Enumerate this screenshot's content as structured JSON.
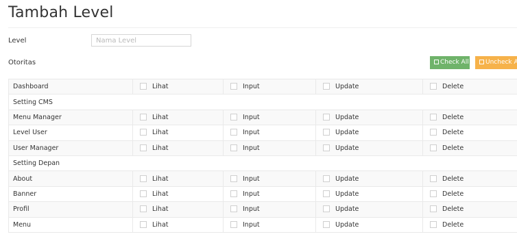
{
  "page": {
    "title": "Tambah Level"
  },
  "form": {
    "level_label": "Level",
    "level_placeholder": "Nama Level",
    "level_value": "",
    "otoritas_label": "Otoritas",
    "check_all_label": "Check All",
    "uncheck_all_label": "Uncheck A"
  },
  "actions": {
    "lihat": "Lihat",
    "input": "Input",
    "update": "Update",
    "delete": "Delete"
  },
  "rows": [
    {
      "type": "item",
      "label": "Dashboard"
    },
    {
      "type": "section",
      "label": "Setting CMS"
    },
    {
      "type": "item",
      "label": "Menu Manager"
    },
    {
      "type": "item",
      "label": "Level User"
    },
    {
      "type": "item",
      "label": "User Manager"
    },
    {
      "type": "section",
      "label": "Setting Depan"
    },
    {
      "type": "item",
      "label": "About"
    },
    {
      "type": "item",
      "label": "Banner"
    },
    {
      "type": "item",
      "label": "Profil"
    },
    {
      "type": "item",
      "label": "Menu"
    }
  ],
  "colors": {
    "check_all": "#6fb36a",
    "uncheck_all": "#f6b24a"
  },
  "icons": {
    "check_all": "checkbox-checked-icon",
    "uncheck_all": "checkbox-empty-icon"
  }
}
